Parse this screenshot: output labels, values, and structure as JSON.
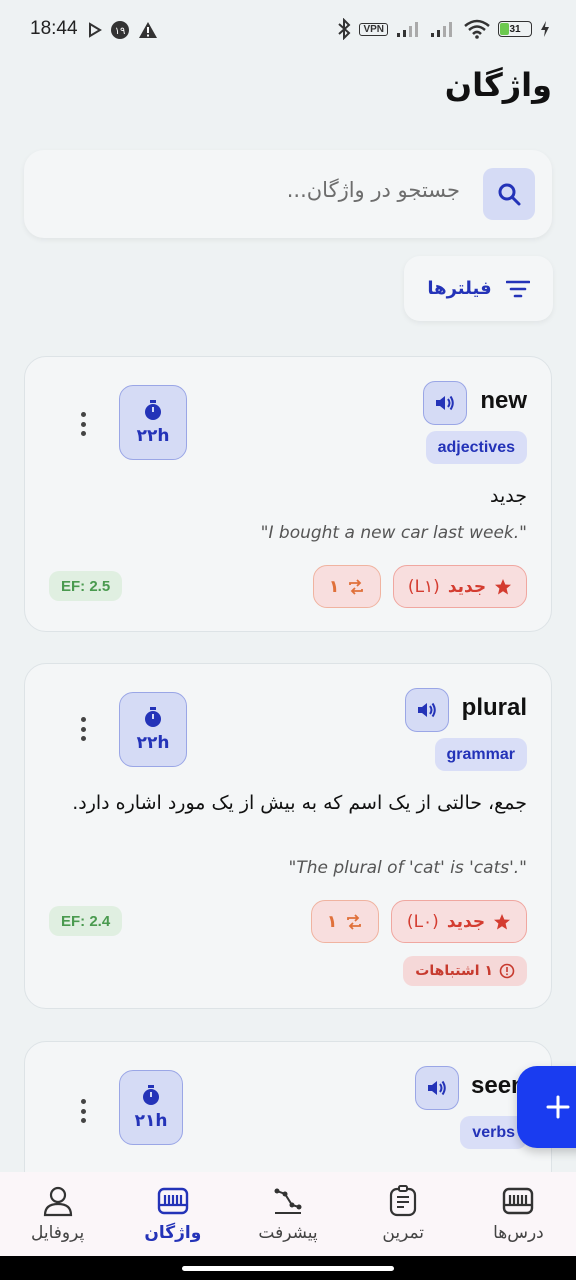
{
  "status_bar": {
    "time": "18:44",
    "vpn": "VPN",
    "battery": "31"
  },
  "page": {
    "title": "واژگان"
  },
  "search": {
    "placeholder": "جستجو در واژگان..."
  },
  "filters": {
    "label": "فیلترها"
  },
  "cards": [
    {
      "word": "new",
      "tag": "adjectives",
      "timer": "۲۲h",
      "meaning": "جدید",
      "example": "\".I bought a new car last week\"",
      "status_label": "جدید",
      "status_level": "(L۱)",
      "repeat_count": "۱",
      "ef": "EF: 2.5"
    },
    {
      "word": "plural",
      "tag": "grammar",
      "timer": "۲۲h",
      "meaning": "جمع، حالتی از یک اسم که به بیش از یک مورد اشاره دارد.",
      "example": "\".'The plural of 'cat' is 'cats\"",
      "status_label": "جدید",
      "status_level": "(L۰)",
      "repeat_count": "۱",
      "ef": "EF: 2.4",
      "mistakes": "۱ اشتباهات"
    },
    {
      "word": "seen",
      "tag": "verbs",
      "timer": "۲۱h"
    }
  ],
  "bottom_nav": [
    {
      "label": "پروفایل",
      "icon": "profile-icon"
    },
    {
      "label": "واژگان",
      "icon": "vocabulary-icon",
      "active": true
    },
    {
      "label": "پیشرفت",
      "icon": "progress-icon"
    },
    {
      "label": "تمرین",
      "icon": "practice-icon"
    },
    {
      "label": "درس‌ها",
      "icon": "lessons-icon"
    }
  ],
  "colors": {
    "accent": "#2433b8",
    "fab": "#1a3cf0",
    "status_red": "#d43c30",
    "ef_green": "#4a9a4f"
  }
}
